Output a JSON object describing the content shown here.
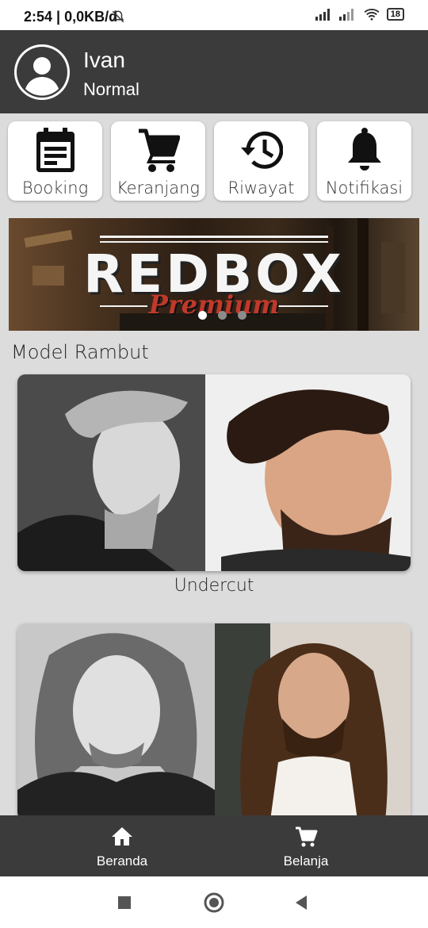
{
  "status_bar": {
    "time": "2:54 | 0,0KB/d",
    "battery": "18",
    "mute_icon": "bell-off-icon"
  },
  "profile": {
    "name": "Ivan",
    "status": "Normal",
    "avatar_icon": "person-icon"
  },
  "menu": [
    {
      "label": "Booking",
      "icon": "calendar-icon"
    },
    {
      "label": "Keranjang",
      "icon": "cart-icon"
    },
    {
      "label": "Riwayat",
      "icon": "history-icon"
    },
    {
      "label": "Notifikasi",
      "icon": "bell-icon"
    }
  ],
  "banner": {
    "title": "REDBOX",
    "subtitle": "Premium",
    "slide_count": 3,
    "active_slide": 1
  },
  "section": {
    "title": "Model Rambut"
  },
  "models": [
    {
      "caption": "Undercut"
    },
    {
      "caption": ""
    }
  ],
  "bottom_nav": [
    {
      "label": "Beranda",
      "icon": "home-icon"
    },
    {
      "label": "Belanja",
      "icon": "shopping-cart-icon"
    }
  ],
  "colors": {
    "header": "#3b3b3b",
    "background": "#dcdcdc",
    "accent": "#c0392b"
  }
}
